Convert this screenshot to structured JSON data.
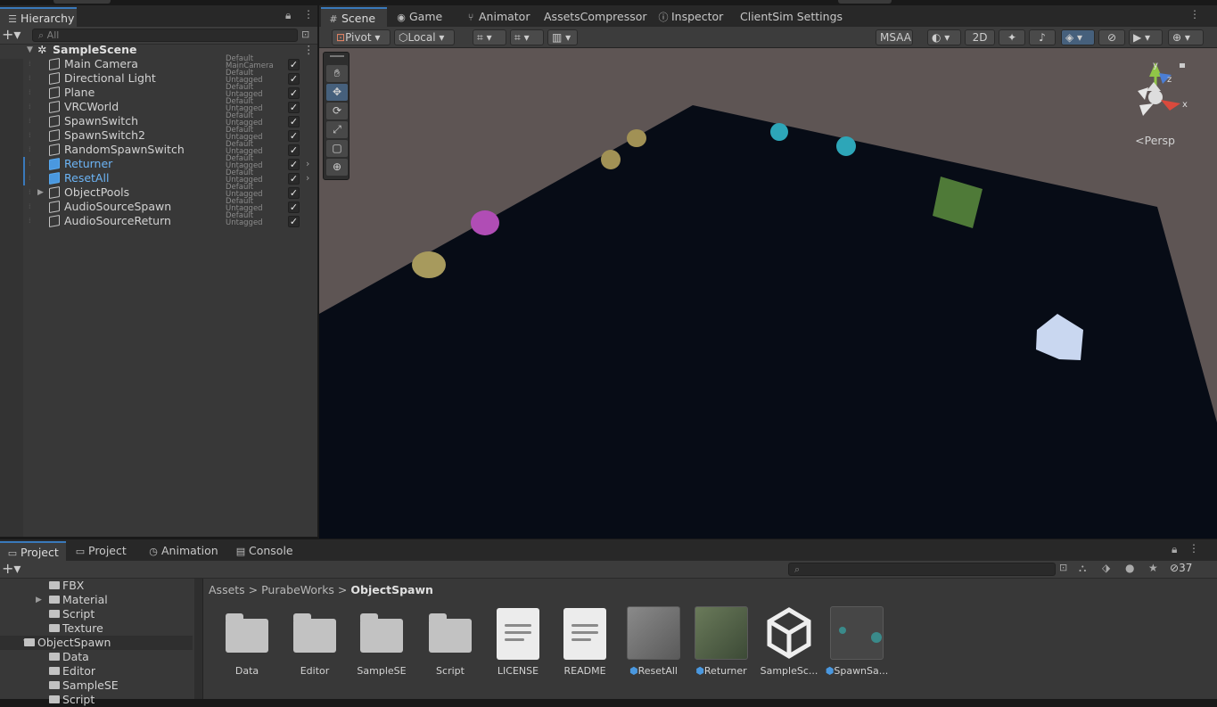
{
  "hierarchy": {
    "tab": "Hierarchy",
    "search_placeholder": "All",
    "scene_name": "SampleScene",
    "items": [
      {
        "name": "Main Camera",
        "tag1": "Default",
        "tag2": "MainCamera"
      },
      {
        "name": "Directional Light",
        "tag1": "Default",
        "tag2": "Untagged"
      },
      {
        "name": "Plane",
        "tag1": "Default",
        "tag2": "Untagged"
      },
      {
        "name": "VRCWorld",
        "tag1": "Default",
        "tag2": "Untagged"
      },
      {
        "name": "SpawnSwitch",
        "tag1": "Default",
        "tag2": "Untagged"
      },
      {
        "name": "SpawnSwitch2",
        "tag1": "Default",
        "tag2": "Untagged"
      },
      {
        "name": "RandomSpawnSwitch",
        "tag1": "Default",
        "tag2": "Untagged"
      },
      {
        "name": "Returner",
        "tag1": "Default",
        "tag2": "Untagged"
      },
      {
        "name": "ResetAll",
        "tag1": "Default",
        "tag2": "Untagged"
      },
      {
        "name": "ObjectPools",
        "tag1": "Default",
        "tag2": "Untagged"
      },
      {
        "name": "AudioSourceSpawn",
        "tag1": "Default",
        "tag2": "Untagged"
      },
      {
        "name": "AudioSourceReturn",
        "tag1": "Default",
        "tag2": "Untagged"
      }
    ]
  },
  "scene": {
    "tabs": [
      "Scene",
      "Game",
      "Animator",
      "AssetsCompressor",
      "Inspector",
      "ClientSim Settings"
    ],
    "pivot": "Pivot",
    "local": "Local",
    "msaa": "MSAA",
    "twod": "2D",
    "persp": "Persp",
    "gizmo_axes": {
      "y": "y",
      "z": "z",
      "x": "x"
    }
  },
  "bottom": {
    "tabs": [
      "Project",
      "Project",
      "Animation",
      "Console"
    ],
    "count": "37",
    "tree": [
      "FBX",
      "Material",
      "Script",
      "Texture",
      "ObjectSpawn",
      "Data",
      "Editor",
      "SampleSE",
      "Script"
    ],
    "breadcrumb": [
      "Assets",
      "PurabeWorks",
      "ObjectSpawn"
    ],
    "assets": [
      "Data",
      "Editor",
      "SampleSE",
      "Script",
      "LICENSE",
      "README",
      "ResetAll",
      "Returner",
      "SampleSc...",
      "SpawnSa..."
    ]
  }
}
